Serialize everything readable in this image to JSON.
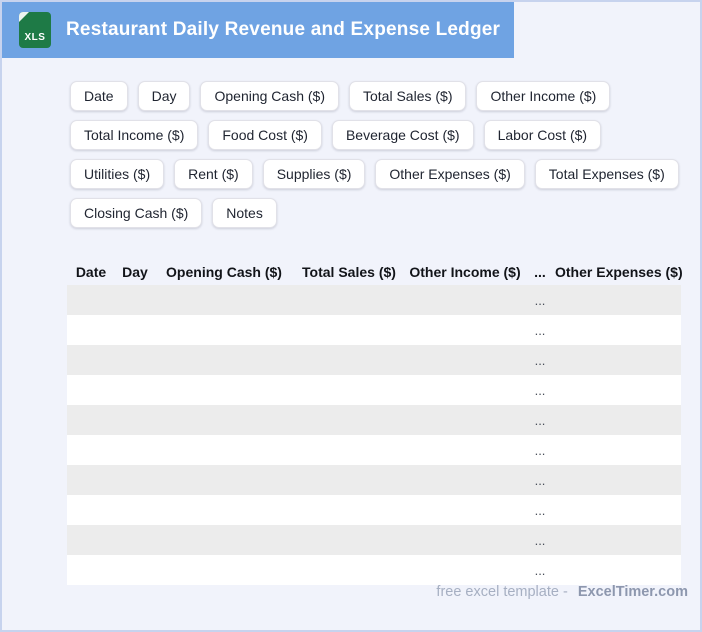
{
  "header": {
    "title": "Restaurant Daily Revenue and Expense Ledger",
    "icon_label": "XLS"
  },
  "colors": {
    "header_bg": "#6FA3E3",
    "icon_green": "#1E7A46",
    "page_bg": "#F1F3FB",
    "row_stripe": "#ECECEC",
    "border": "#C7D3EE"
  },
  "chips": [
    "Date",
    "Day",
    "Opening Cash ($)",
    "Total Sales ($)",
    "Other Income ($)",
    "Total Income ($)",
    "Food Cost ($)",
    "Beverage Cost ($)",
    "Labor Cost ($)",
    "Utilities ($)",
    "Rent ($)",
    "Supplies ($)",
    "Other Expenses ($)",
    "Total Expenses ($)",
    "Closing Cash ($)",
    "Notes"
  ],
  "table": {
    "columns": [
      "Date",
      "Day",
      "Opening Cash ($)",
      "Total Sales ($)",
      "Other Income ($)",
      "...",
      "Other Expenses ($)"
    ],
    "row_count": 10,
    "placeholder": "...",
    "placeholder_column_index": 5
  },
  "footer": {
    "text": "free excel template -",
    "brand": "ExcelTimer.com"
  }
}
